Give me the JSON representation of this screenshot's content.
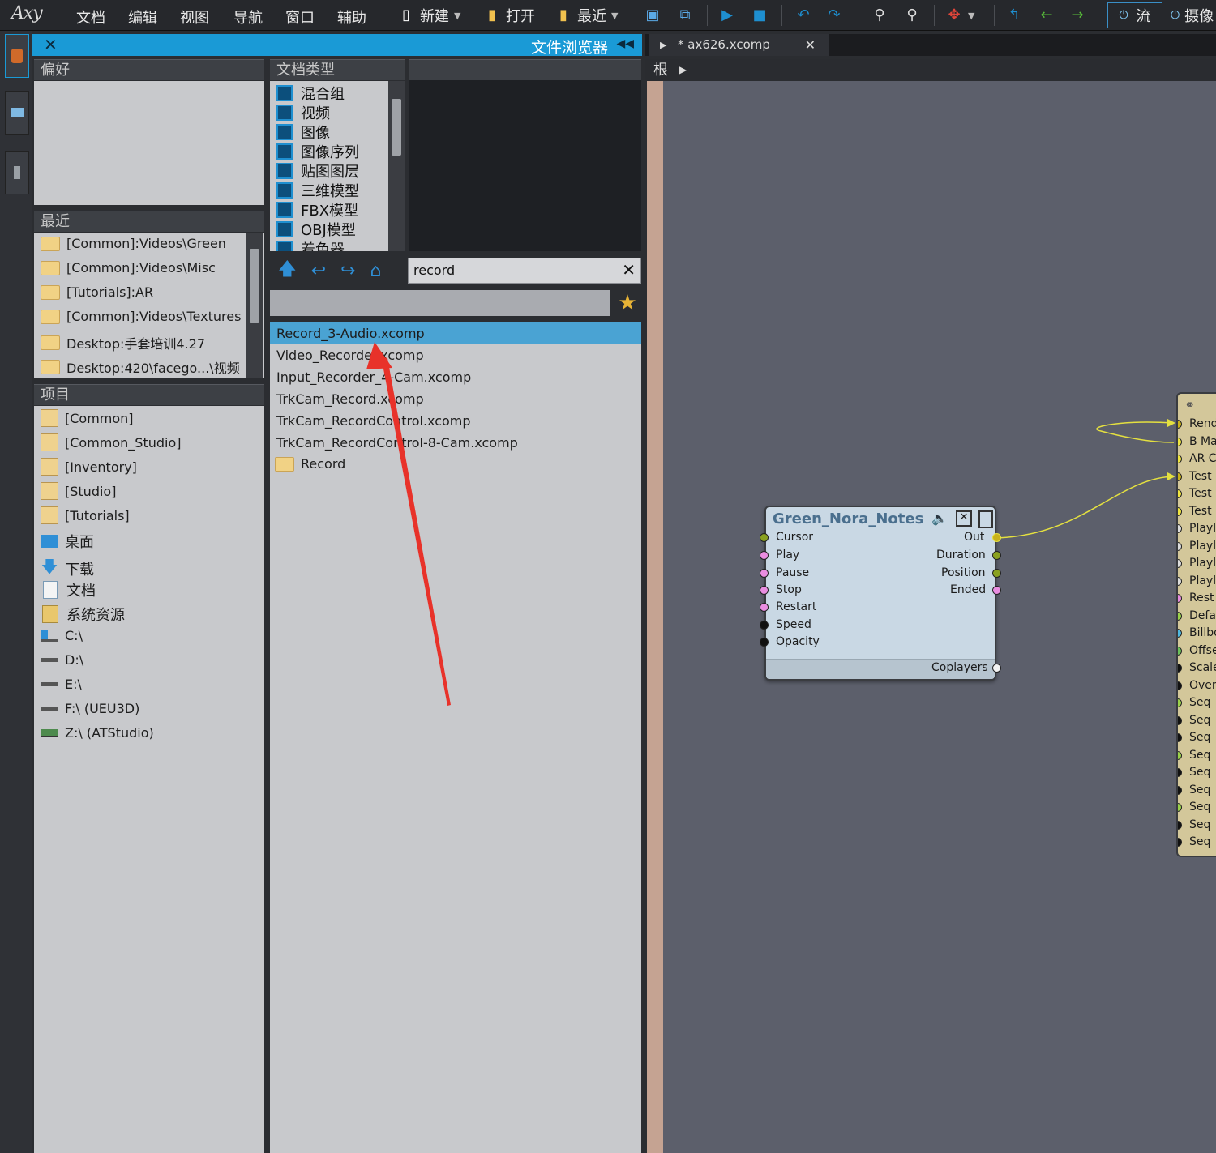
{
  "menubar": {
    "logo": "Axy",
    "items": [
      "文档",
      "编辑",
      "视图",
      "导航",
      "窗口",
      "辅助"
    ],
    "new_label": "新建",
    "open_label": "打开",
    "recent_label": "最近",
    "flow_label": "流",
    "capture_label": "摄像"
  },
  "browser": {
    "title": "文件浏览器",
    "favorites_header": "偏好",
    "recent_header": "最近",
    "recent_items": [
      "[Common]:Videos\\Green",
      "[Common]:Videos\\Misc",
      "[Tutorials]:AR",
      "[Common]:Videos\\Textures",
      "Desktop:手套培训4.27",
      "Desktop:420\\facego...\\视频"
    ],
    "projects_header": "项目",
    "projects": [
      "[Common]",
      "[Common_Studio]",
      "[Inventory]",
      "[Studio]",
      "[Tutorials]"
    ],
    "locations": [
      "桌面",
      "下载",
      "文档",
      "系统资源"
    ],
    "drives": [
      "C:\\",
      "D:\\",
      "E:\\",
      "F:\\ (UEU3D)",
      "Z:\\ (ATStudio)"
    ],
    "doctype_header": "文档类型",
    "doctypes": [
      "混合组",
      "视频",
      "图像",
      "图像序列",
      "贴图图层",
      "三维模型",
      "FBX模型",
      "OBJ模型",
      "着色器"
    ],
    "search_value": "record",
    "files": [
      "Record_3-Audio.xcomp",
      "Video_Recorder.xcomp",
      "Input_Recorder_4-Cam.xcomp",
      "TrkCam_Record.xcomp",
      "TrkCam_RecordControl.xcomp",
      "TrkCam_RecordControl-8-Cam.xcomp"
    ],
    "folder_result": "Record"
  },
  "editor": {
    "tab_label": "* ax626.xcomp",
    "breadcrumb_root": "根"
  },
  "node": {
    "title": "Green_Nora_Notes",
    "inputs": [
      "Cursor",
      "Play",
      "Pause",
      "Stop",
      "Restart",
      "Speed",
      "Opacity"
    ],
    "outputs": [
      "Out",
      "Duration",
      "Position",
      "Ended"
    ],
    "footer": "Coplayers"
  },
  "right_node": {
    "ports": [
      "Rend",
      "B Ma",
      "AR C",
      "Test",
      "Test",
      "Test",
      "Playl",
      "Playl",
      "Playl",
      "Playl",
      "Rest",
      "Defa",
      "Billbo",
      "Offse",
      "Scale",
      "Overl",
      "Seq",
      "Seq",
      "Seq",
      "Seq",
      "Seq",
      "Seq",
      "Seq",
      "Seq",
      "Seq"
    ]
  },
  "colors": {
    "accent": "#1a9ad6",
    "selection": "#4aa3d3",
    "graph_bg": "#5c5f6b",
    "node_bg": "#c9d8e4",
    "right_node_bg": "#d3c79a",
    "annotation_arrow": "#e8322a"
  }
}
